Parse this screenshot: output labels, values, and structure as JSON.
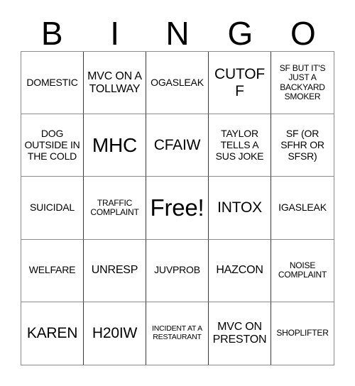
{
  "card": {
    "header_letters": [
      "B",
      "I",
      "N",
      "G",
      "O"
    ],
    "cells": [
      {
        "text": "DOMESTIC",
        "size": "fs-m"
      },
      {
        "text": "MVC ON A TOLLWAY",
        "size": "fs-l"
      },
      {
        "text": "OGASLEAK",
        "size": "fs-m"
      },
      {
        "text": "CUTOFF",
        "size": "fs-xl"
      },
      {
        "text": "SF BUT IT'S JUST A BACKYARD SMOKER",
        "size": "fs-s"
      },
      {
        "text": "DOG OUTSIDE IN THE COLD",
        "size": "fs-m"
      },
      {
        "text": "MHC",
        "size": "fs-xxl"
      },
      {
        "text": "CFAIW",
        "size": "fs-xl"
      },
      {
        "text": "TAYLOR TELLS A SUS JOKE",
        "size": "fs-m"
      },
      {
        "text": "SF (OR SFHR OR SFSR)",
        "size": "fs-m"
      },
      {
        "text": "SUICIDAL",
        "size": "fs-m"
      },
      {
        "text": "TRAFFIC COMPLAINT",
        "size": "fs-s"
      },
      {
        "text": "Free!",
        "size": "fs-free"
      },
      {
        "text": "INTOX",
        "size": "fs-xl"
      },
      {
        "text": "IGASLEAK",
        "size": "fs-m"
      },
      {
        "text": "WELFARE",
        "size": "fs-m"
      },
      {
        "text": "UNRESP",
        "size": "fs-l"
      },
      {
        "text": "JUVPROB",
        "size": "fs-m"
      },
      {
        "text": "HAZCON",
        "size": "fs-l"
      },
      {
        "text": "NOISE COMPLAINT",
        "size": "fs-s"
      },
      {
        "text": "KAREN",
        "size": "fs-xl"
      },
      {
        "text": "H20IW",
        "size": "fs-xl"
      },
      {
        "text": "INCIDENT AT A RESTAURANT",
        "size": "fs-xs"
      },
      {
        "text": "MVC ON PRESTON",
        "size": "fs-l"
      },
      {
        "text": "SHOPLIFTER",
        "size": "fs-s"
      }
    ]
  },
  "colors": {
    "background": "#ffffff",
    "text": "#000000",
    "grid_line": "#8c8c8c"
  }
}
